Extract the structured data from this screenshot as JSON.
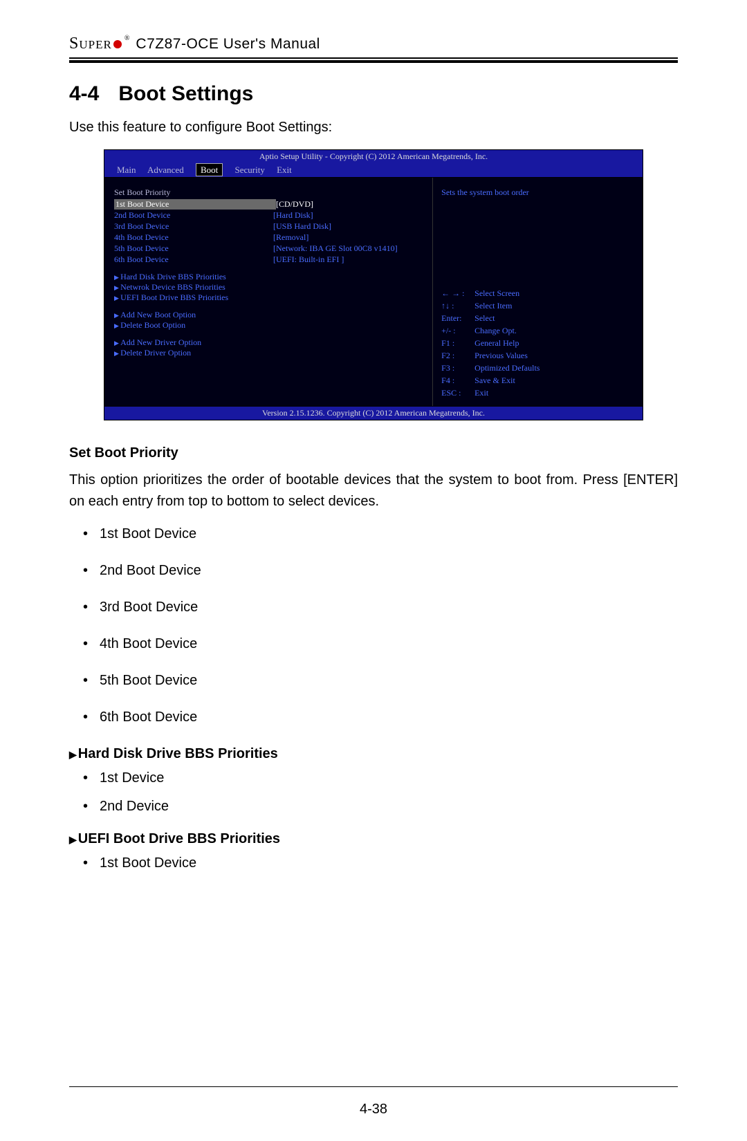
{
  "header": {
    "brand": "Super",
    "doc": "C7Z87-OCE User's Manual"
  },
  "section": {
    "number": "4-4",
    "title": "Boot Settings",
    "intro": "Use this feature to configure Boot Settings:"
  },
  "bios": {
    "title": "Aptio Setup Utility - Copyright (C) 2012 American Megatrends, Inc.",
    "tabs": [
      "Main",
      "Advanced",
      "Boot",
      "Security",
      "Exit"
    ],
    "active_tab": "Boot",
    "left": {
      "heading": "Set Boot Priority",
      "rows": [
        {
          "k": "1st Boot Device",
          "v": "[CD/DVD]",
          "hl": true
        },
        {
          "k": "2nd Boot Device",
          "v": "[Hard Disk]"
        },
        {
          "k": "3rd Boot Device",
          "v": "[USB Hard Disk]"
        },
        {
          "k": "4th Boot Device",
          "v": "[Removal]"
        },
        {
          "k": "5th Boot Device",
          "v": "[Network: IBA GE Slot 00C8 v1410]"
        },
        {
          "k": "6th Boot Device",
          "v": "[UEFI: Built-in EFI ]"
        }
      ],
      "subs1": [
        "Hard Disk Drive BBS Priorities",
        "Netwrok Device BBS Priorities",
        "UEFI Boot Drive BBS Priorities"
      ],
      "subs2": [
        "Add New Boot Option",
        "Delete Boot Option"
      ],
      "subs3": [
        "Add New Driver Option",
        "Delete Driver Option"
      ]
    },
    "right": {
      "help": "Sets the system boot order",
      "keys": [
        {
          "k": "← → :",
          "v": "Select Screen"
        },
        {
          "k": "↑↓  :",
          "v": "Select Item"
        },
        {
          "k": "Enter:",
          "v": "Select"
        },
        {
          "k": "+/- :",
          "v": "Change Opt."
        },
        {
          "k": "F1 :",
          "v": "General Help"
        },
        {
          "k": "F2 :",
          "v": "Previous Values"
        },
        {
          "k": "F3 :",
          "v": "Optimized Defaults"
        },
        {
          "k": "F4 :",
          "v": "Save & Exit"
        },
        {
          "k": "ESC :",
          "v": "Exit"
        }
      ]
    },
    "footer": "Version 2.15.1236. Copyright (C) 2012 American Megatrends, Inc."
  },
  "body": {
    "subheading1": "Set Boot Priority",
    "para1": "This option prioritizes the order of bootable devices that the system to boot from. Press [ENTER] on each entry from top to bottom to select devices.",
    "list1": [
      "1st Boot Device",
      "2nd Boot Device",
      "3rd Boot Device",
      "4th Boot Device",
      "5th Boot Device",
      "6th Boot Device"
    ],
    "subheading2": "Hard Disk Drive BBS Priorities",
    "list2": [
      "1st Device",
      "2nd Device"
    ],
    "subheading3": "UEFI Boot Drive BBS Priorities",
    "list3": [
      "1st Boot Device"
    ]
  },
  "pager": "4-38"
}
